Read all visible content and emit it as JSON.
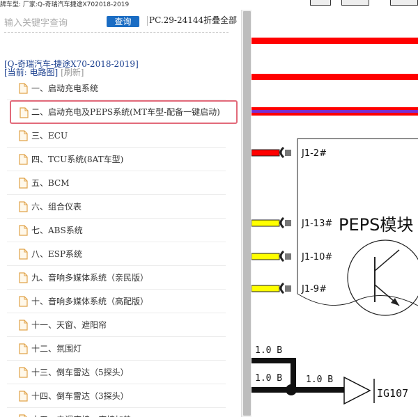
{
  "header": {
    "breadcrumb": "牌车型:   厂家:Q-奇瑞汽车捷途X702018-2019"
  },
  "search": {
    "placeholder": "输入关键字查询",
    "button_label": "查询"
  },
  "pc_info": "PC.29-24144折叠全部",
  "vehicle_line": "[Q-奇瑞汽车-捷途X70-2018-2019]",
  "current": {
    "label": "[当前: 电路图]",
    "refresh": "[刷新]"
  },
  "tree_items": [
    {
      "label": "一、启动充电系统",
      "selected": false
    },
    {
      "label": "二、启动充电及PEPS系统(MT车型-配备一键启动)",
      "selected": true
    },
    {
      "label": "三、ECU",
      "selected": false
    },
    {
      "label": "四、TCU系统(8AT车型)",
      "selected": false
    },
    {
      "label": "五、BCM",
      "selected": false
    },
    {
      "label": "六、组合仪表",
      "selected": false
    },
    {
      "label": "七、ABS系统",
      "selected": false
    },
    {
      "label": "八、ESP系统",
      "selected": false
    },
    {
      "label": "九、音响多媒体系统（亲民版）",
      "selected": false
    },
    {
      "label": "十、音响多媒体系统（高配版）",
      "selected": false
    },
    {
      "label": "十一、天窗、遮阳帘",
      "selected": false
    },
    {
      "label": "十二、氛围灯",
      "selected": false
    },
    {
      "label": "十三、倒车雷达（5探头）",
      "selected": false
    },
    {
      "label": "十四、倒车雷达（3探头）",
      "selected": false
    },
    {
      "label": "十五、电调座椅、座椅加热",
      "selected": false
    }
  ],
  "diagram": {
    "module_label": "PEPS模块",
    "pins": [
      "J1-2#",
      "J1-13#",
      "J1-10#",
      "J1-9#"
    ],
    "wire_labels": [
      "1.0 B",
      "1.0 B",
      "1.0 B"
    ],
    "ground_label": "IG107"
  },
  "colors": {
    "accent": "#1a6cc3",
    "selection_border": "#e26a7a",
    "wire_red": "#ff0000",
    "wire_yellow": "#ffff00",
    "wire_purple": "#7a2fd0",
    "folder_icon": "#e0a34a"
  }
}
